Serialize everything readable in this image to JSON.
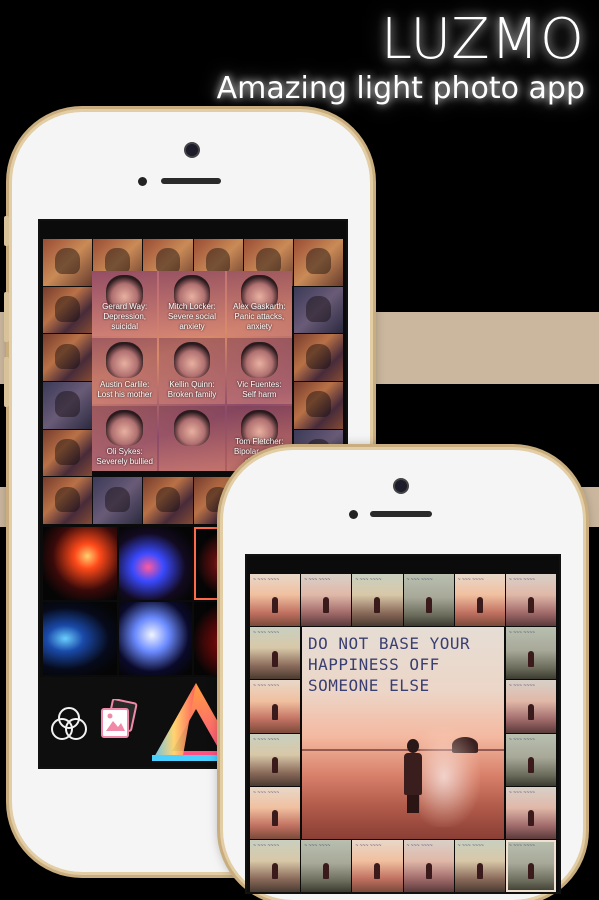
{
  "brand": {
    "name": "LUZMO",
    "tagline": "Amazing light photo app"
  },
  "phone1": {
    "collage_captions": [
      "Gerard Way:\nDepression, suicidal",
      "Mitch Locker:\nSevere social anxiety",
      "Alex Gaskarth:\nPanic attacks, anxiety",
      "Austin Carlile:\nLost his mother",
      "Kellin Quinn:\nBroken family",
      "Vic Fuentes:\nSelf harm",
      "Oli Sykes:\nSeverely bullied",
      "",
      "Tom Fletcher:\nBipolar, eating disorder"
    ],
    "toolbar": {
      "icons": [
        "circles-icon",
        "photos-icon",
        "prism-icon"
      ]
    }
  },
  "phone2": {
    "quote_lines": [
      "DO NOT BASE YOUR",
      "HAPPINESS OFF",
      "SOMEONE ELSE"
    ]
  },
  "colors": {
    "background": "#000000",
    "stripe": "#cbb79e",
    "phone_frame": "#f5f5f5",
    "gold_trim": "#c9ad7e"
  }
}
